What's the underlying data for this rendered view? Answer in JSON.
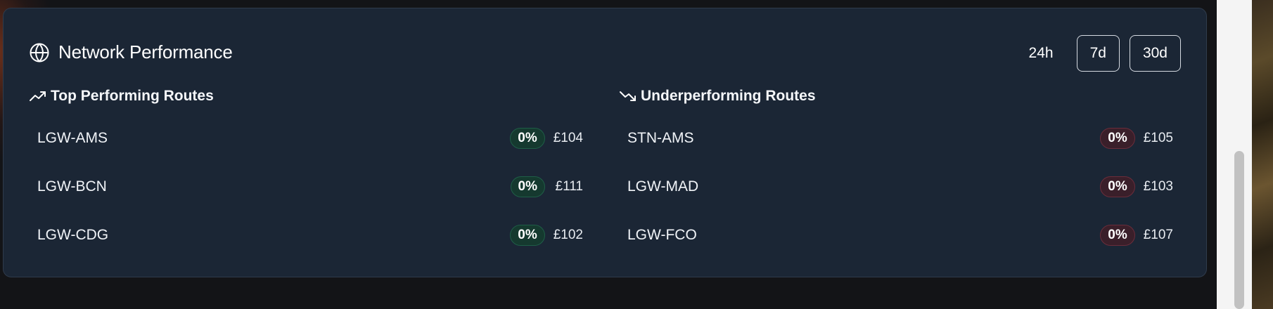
{
  "panel": {
    "title": "Network Performance",
    "icon": "globe-icon",
    "ranges": [
      {
        "label": "24h",
        "selected": true
      },
      {
        "label": "7d",
        "selected": false
      },
      {
        "label": "30d",
        "selected": false
      }
    ]
  },
  "top_routes": {
    "title": "Top Performing Routes",
    "icon": "trending-up-icon",
    "items": [
      {
        "route": "LGW-AMS",
        "change": "0%",
        "price": "£104"
      },
      {
        "route": "LGW-BCN",
        "change": "0%",
        "price": "£111"
      },
      {
        "route": "LGW-CDG",
        "change": "0%",
        "price": "£102"
      }
    ]
  },
  "under_routes": {
    "title": "Underperforming Routes",
    "icon": "trending-down-icon",
    "items": [
      {
        "route": "STN-AMS",
        "change": "0%",
        "price": "£105"
      },
      {
        "route": "LGW-MAD",
        "change": "0%",
        "price": "£103"
      },
      {
        "route": "LGW-FCO",
        "change": "0%",
        "price": "£107"
      }
    ]
  },
  "colors": {
    "card_bg": "#1b2635",
    "positive": "#15392f",
    "negative": "#3a1f2a"
  }
}
